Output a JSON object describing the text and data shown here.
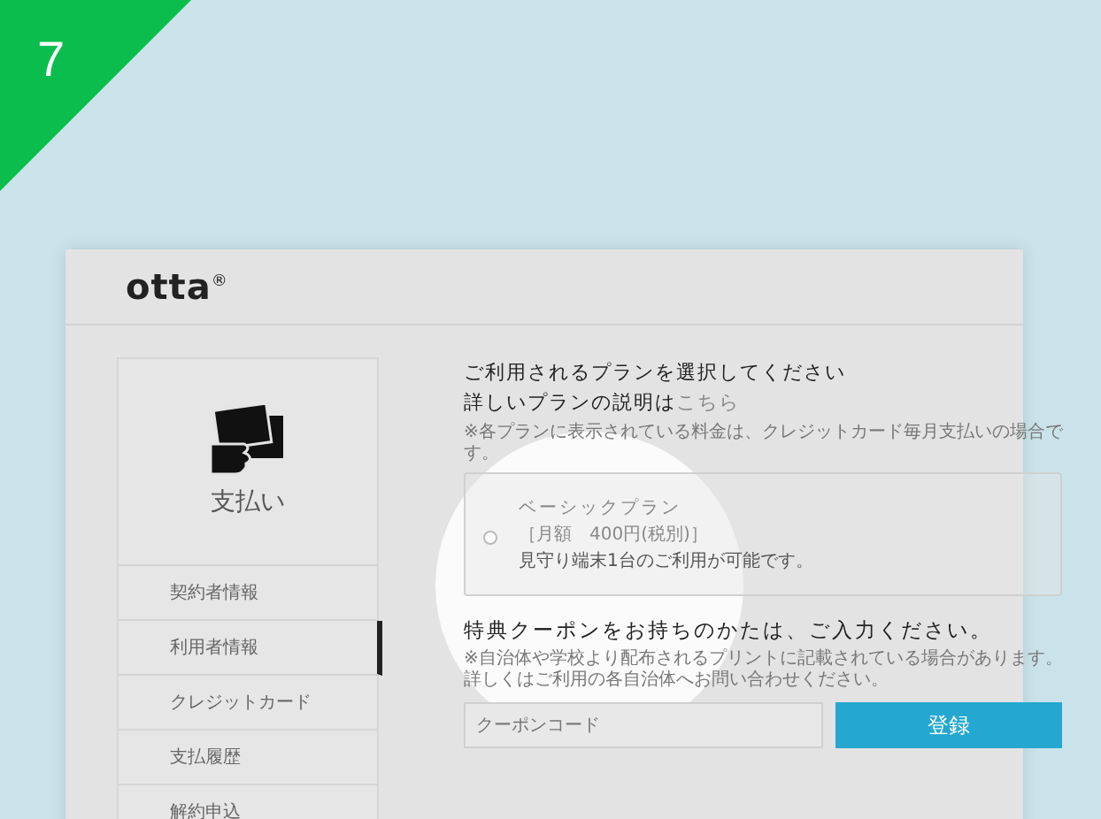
{
  "step_badge": "7",
  "logo": {
    "text": "otta",
    "mark": "®"
  },
  "sidebar": {
    "title": "支払い",
    "items": [
      {
        "label": "契約者情報",
        "selected": false
      },
      {
        "label": "利用者情報",
        "selected": true
      },
      {
        "label": "クレジットカード",
        "selected": false
      },
      {
        "label": "支払履歴",
        "selected": false
      },
      {
        "label": "解約申込",
        "selected": false
      }
    ]
  },
  "plan_section": {
    "heading": "ご利用されるプランを選択してください",
    "detail_text": "詳しいプランの説明は",
    "detail_link": "こちら",
    "note": "※各プランに表示されている料金は、クレジットカード毎月支払いの場合です。",
    "plans": [
      {
        "name": "ベーシックプラン",
        "price": "［月額　400円(税別)］",
        "description": "見守り端末1台のご利用が可能です。",
        "selected": false
      }
    ]
  },
  "coupon_section": {
    "heading": "特典クーポンをお持ちのかたは、ご入力ください。",
    "notes": [
      "※自治体や学校より配布されるプリントに記載されている場合があります。",
      "詳しくはご利用の各自治体へお問い合わせください。"
    ],
    "input": {
      "placeholder": "クーポンコード"
    },
    "button": "登録"
  }
}
